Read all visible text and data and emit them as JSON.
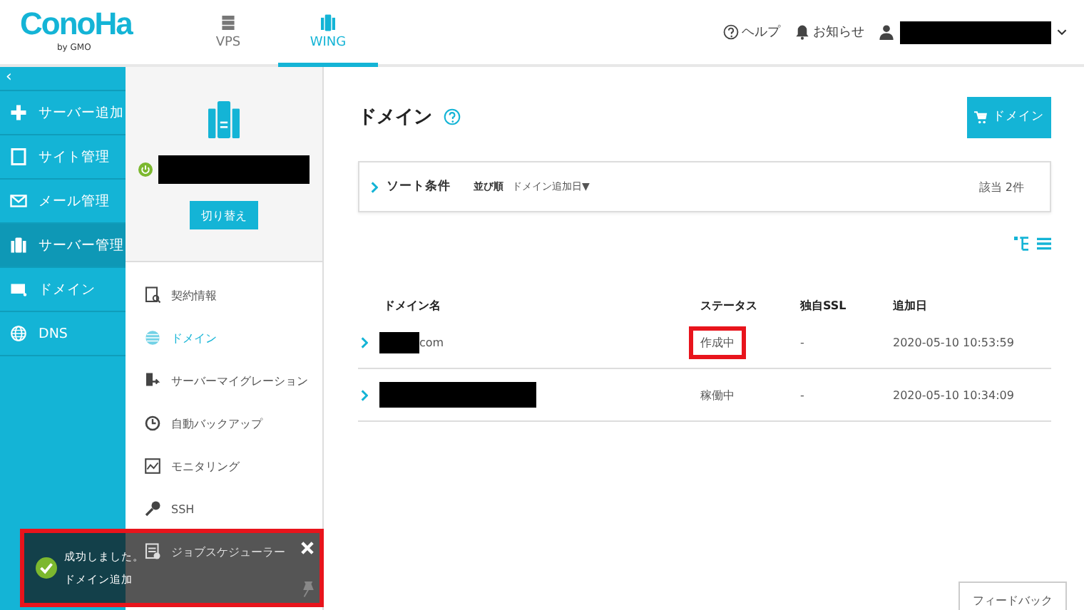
{
  "header": {
    "logo": "ConoHa",
    "logo_sub": "by GMO",
    "tabs": [
      {
        "label": "VPS",
        "kind": "vps",
        "selected": false
      },
      {
        "label": "WING",
        "kind": "wing",
        "selected": true
      }
    ],
    "help": "ヘルプ",
    "notice": "お知らせ"
  },
  "sidebar": {
    "collapse": "‹",
    "items": [
      {
        "label": "サーバー追加",
        "kind": "plus",
        "selected": false
      },
      {
        "label": "サイト管理",
        "kind": "site",
        "selected": false
      },
      {
        "label": "メール管理",
        "kind": "mail",
        "selected": false
      },
      {
        "label": "サーバー管理",
        "kind": "server",
        "selected": true
      },
      {
        "label": "ドメイン",
        "kind": "domain",
        "selected": false
      },
      {
        "label": "DNS",
        "kind": "globe",
        "selected": false
      }
    ]
  },
  "server_panel": {
    "switch_button": "切り替え",
    "running": true,
    "menu": [
      {
        "label": "契約情報",
        "kind": "contract",
        "selected": false
      },
      {
        "label": "ドメイン",
        "kind": "globe",
        "selected": true
      },
      {
        "label": "サーバーマイグレーション",
        "kind": "migrate",
        "selected": false
      },
      {
        "label": "自動バックアップ",
        "kind": "backup",
        "selected": false
      },
      {
        "label": "モニタリング",
        "kind": "monitor",
        "selected": false
      },
      {
        "label": "SSH",
        "kind": "key",
        "selected": false
      },
      {
        "label": "ジョブスケジューラー",
        "kind": "job",
        "selected": false
      }
    ]
  },
  "main": {
    "title": "ドメイン",
    "add_button": "ドメイン",
    "sort": {
      "label": "ソート条件",
      "order_label": "並び順",
      "order_value": "ドメイン追加日▼",
      "count": "該当 2件"
    },
    "table": {
      "columns": [
        "ドメイン名",
        "ステータス",
        "独自SSL",
        "追加日"
      ],
      "rows": [
        {
          "name_suffix": "com",
          "status": "作成中",
          "status_highlighted": true,
          "ssl": "-",
          "added": "2020-05-10 10:53:59"
        },
        {
          "status": "稼働中",
          "status_highlighted": false,
          "ssl": "-",
          "added": "2020-05-10 10:34:09"
        }
      ]
    },
    "feedback": "フィードバック"
  },
  "toast": {
    "lines": [
      "成功しました。",
      "ドメイン追加"
    ],
    "highlighted": true
  }
}
